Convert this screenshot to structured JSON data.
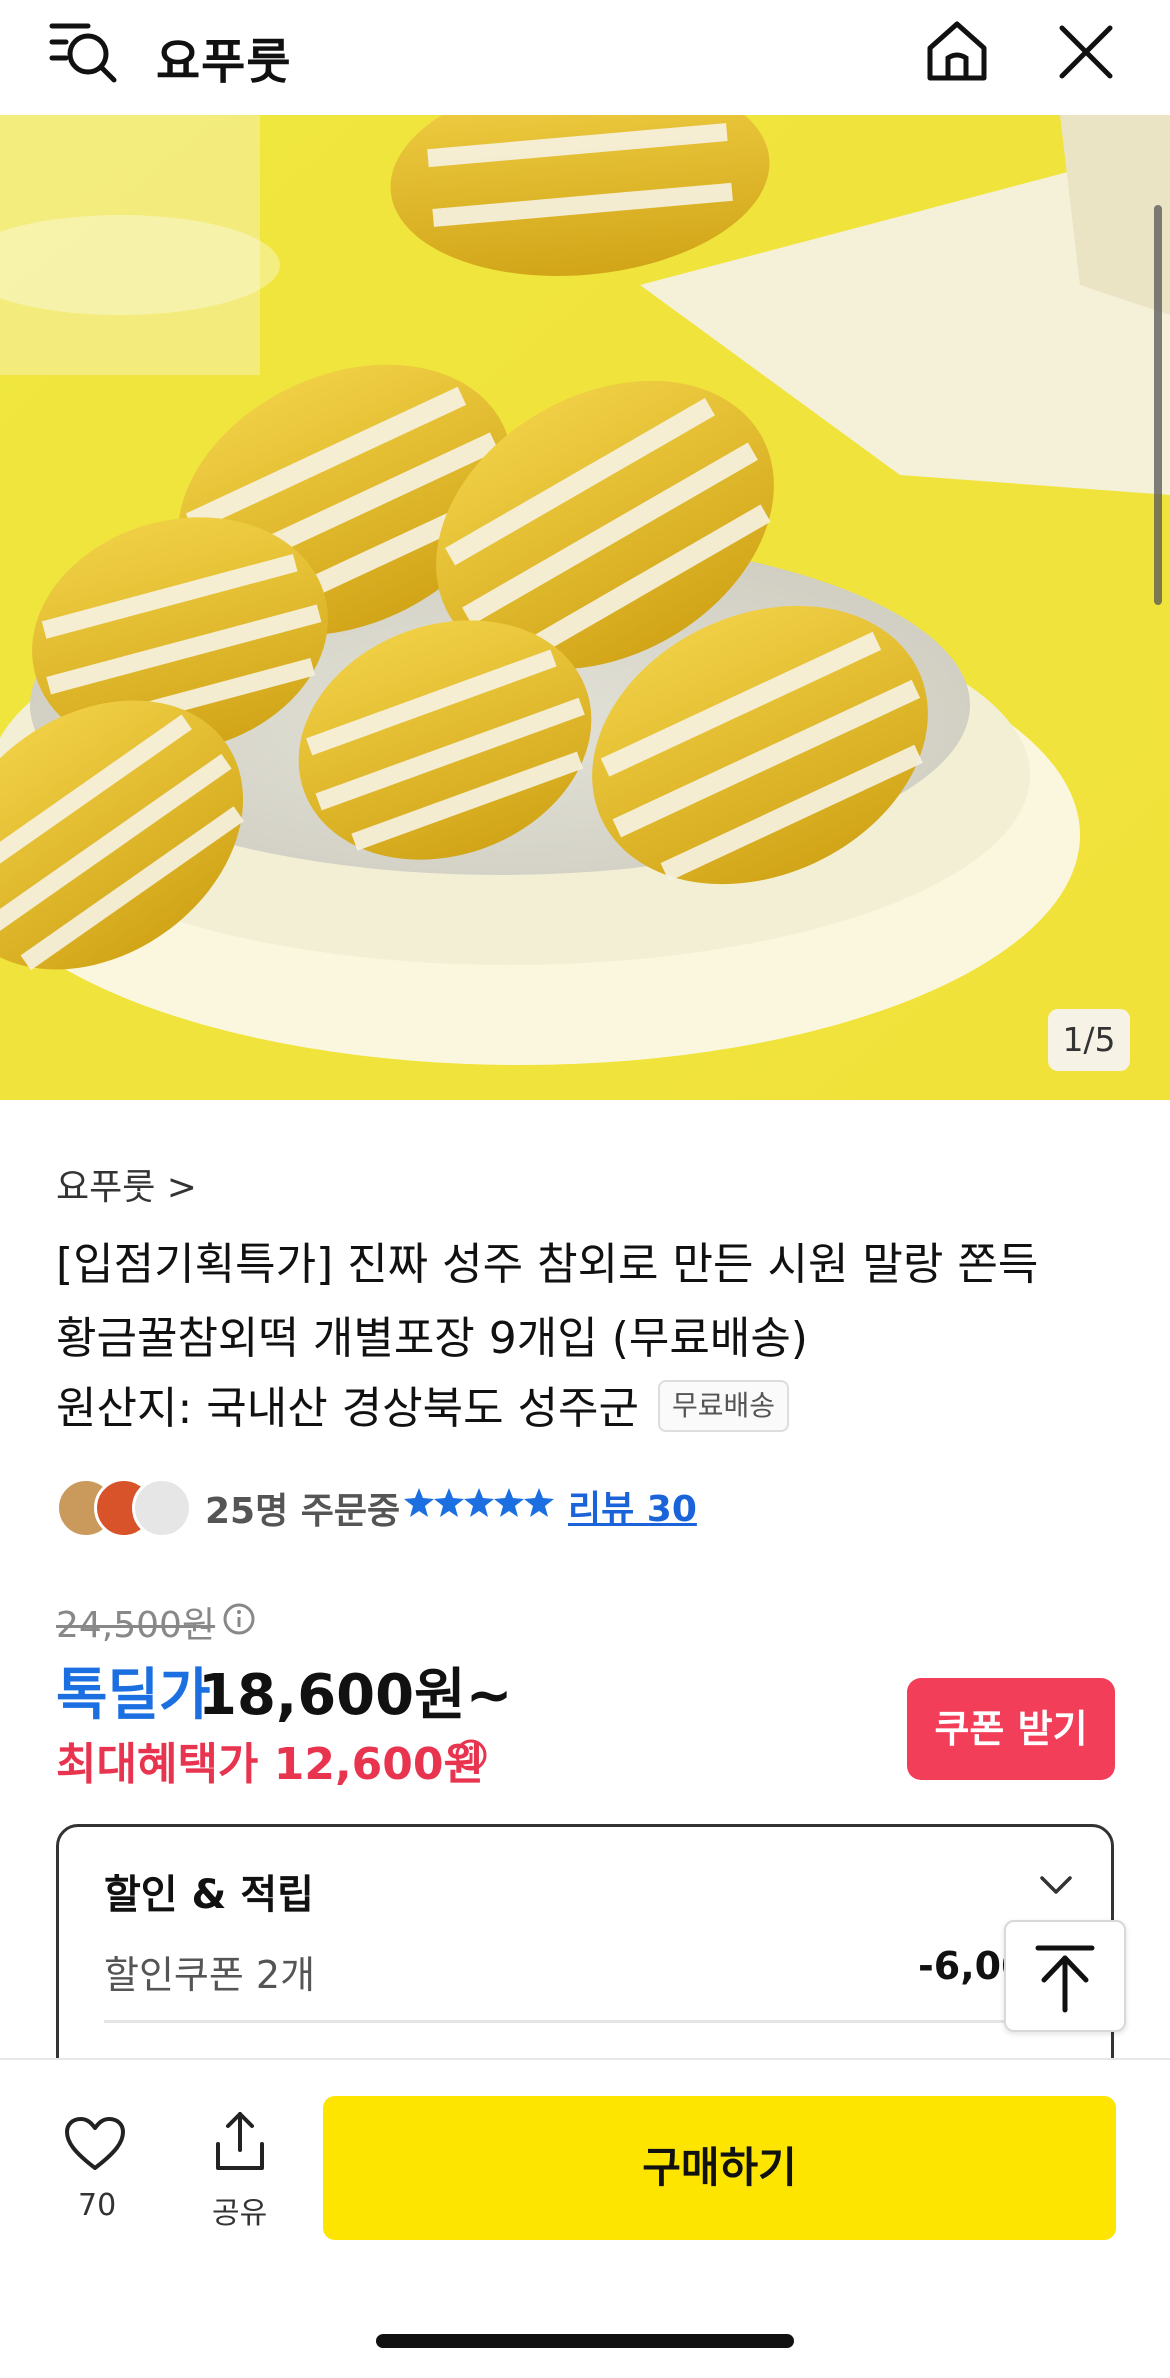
{
  "header": {
    "title": "요푸룻"
  },
  "hero": {
    "counter": "1/5"
  },
  "product": {
    "store": "요푸룻 >",
    "title_line1": "[입점기획특가] 진짜 성주 참외로 만든 시원 말랑 쫀득",
    "title_line2": "황금꿀참외떡 개별포장 9개입 (무료배송)",
    "origin": "원산지: 국내산 경상북도 성주군",
    "shipping_badge": "무료배송",
    "orders": "25명 주문중",
    "rating_stars": 5,
    "review": "리뷰 30"
  },
  "price": {
    "original": "24,500원",
    "deal_label": "톡딜가",
    "deal_price": "18,600원~",
    "max_benefit": "최대혜택가 12,600원",
    "coupon_button": "쿠폰 받기"
  },
  "benefits": {
    "title": "할인 & 적립",
    "coupon_label": "할인쿠폰 2개",
    "coupon_amount": "-6,00"
  },
  "bottom": {
    "like_count": "70",
    "share_label": "공유",
    "buy_button": "구매하기"
  },
  "colors": {
    "deal_blue": "#1b6fe0",
    "benefit_red": "#e8344f",
    "coupon_button": "#f33e5a",
    "buy_button": "#fde500"
  }
}
